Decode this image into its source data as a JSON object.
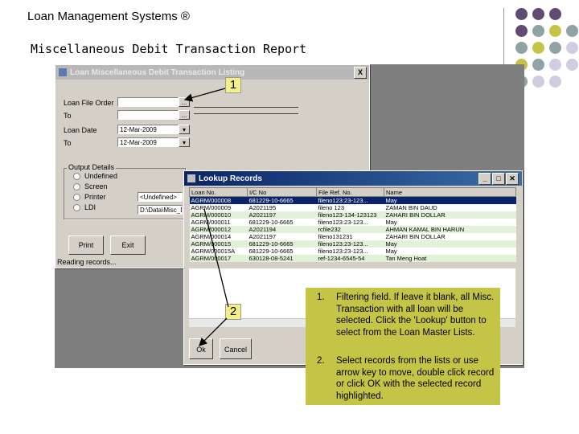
{
  "slide": {
    "title": "Loan Management Systems ®",
    "report_title": "Miscellaneous Debit Transaction Report"
  },
  "main_window": {
    "title": "Loan Miscellaneous Debit Transaction Listing",
    "close_label": "X",
    "labels": {
      "loan_file_order": "Loan File Order",
      "to1": "To",
      "loan_date": "Loan Date",
      "to2": "To"
    },
    "from_date": "12-Mar-2009",
    "to_date": "12-Mar-2009",
    "output_group": "Output Details",
    "output_options": [
      "Undefined",
      "Screen",
      "Printer",
      "LDI"
    ],
    "printer_value": "<Undefined>",
    "ldi_value": "D:\\Data\\Misc_Debit",
    "print_button": "Print",
    "exit_button": "Exit",
    "status": "Reading records..."
  },
  "lookup": {
    "title": "Lookup Records",
    "columns": [
      "Loan No.",
      "I/C No",
      "File Ref. No.",
      "Name"
    ],
    "rows": [
      [
        "AGRM/000008",
        "681229-10-6665",
        "fileno123:23-123...",
        "May"
      ],
      [
        "AGRM/000009",
        "A2021195",
        "fileno 123",
        "ZAMAN BIN DAUD"
      ],
      [
        "AGRM/000010",
        "A2021197",
        "fileno123-134-123123",
        "ZAHARI BIN DOLLAR"
      ],
      [
        "AGRM/000011",
        "681229-10-6665",
        "fileno123:23-123...",
        "May"
      ],
      [
        "AGRM/000012",
        "A2021194",
        "rcfile232",
        "AHMAN KAMAL BIN HARUN"
      ],
      [
        "AGRM/000014",
        "A2021197",
        "fileno131231",
        "ZAHARI BIN DOLLAR"
      ],
      [
        "AGRM/000015",
        "681229-10-6665",
        "fileno123:23-123...",
        "May"
      ],
      [
        "AGRM/000015A",
        "681229-10-6665",
        "fileno123:23-123...",
        "May"
      ],
      [
        "AGRM/000017",
        "630128-08-5241",
        "ref-1234-6545-54",
        "Tan Meng Hoat"
      ]
    ],
    "ok_button": "Ok",
    "cancel_button": "Cancel"
  },
  "callouts": [
    "1",
    "2"
  ],
  "notes": [
    {
      "num": "1.",
      "text": "Filtering field. If leave it blank, all Misc. Transaction with all loan will be selected. Click the 'Lookup' button to select from the Loan Master Lists."
    },
    {
      "num": "2.",
      "text": "Select records from the lists or use arrow key to move, double click record or click OK with the selected record highlighted."
    }
  ],
  "colors": {
    "purple": "#5f4b74",
    "teal": "#8fa2a4",
    "olive": "#c4c447",
    "lavender": "#d0cde0",
    "note_bg": "#c4c447",
    "grid_even": "#e2f2d8"
  }
}
